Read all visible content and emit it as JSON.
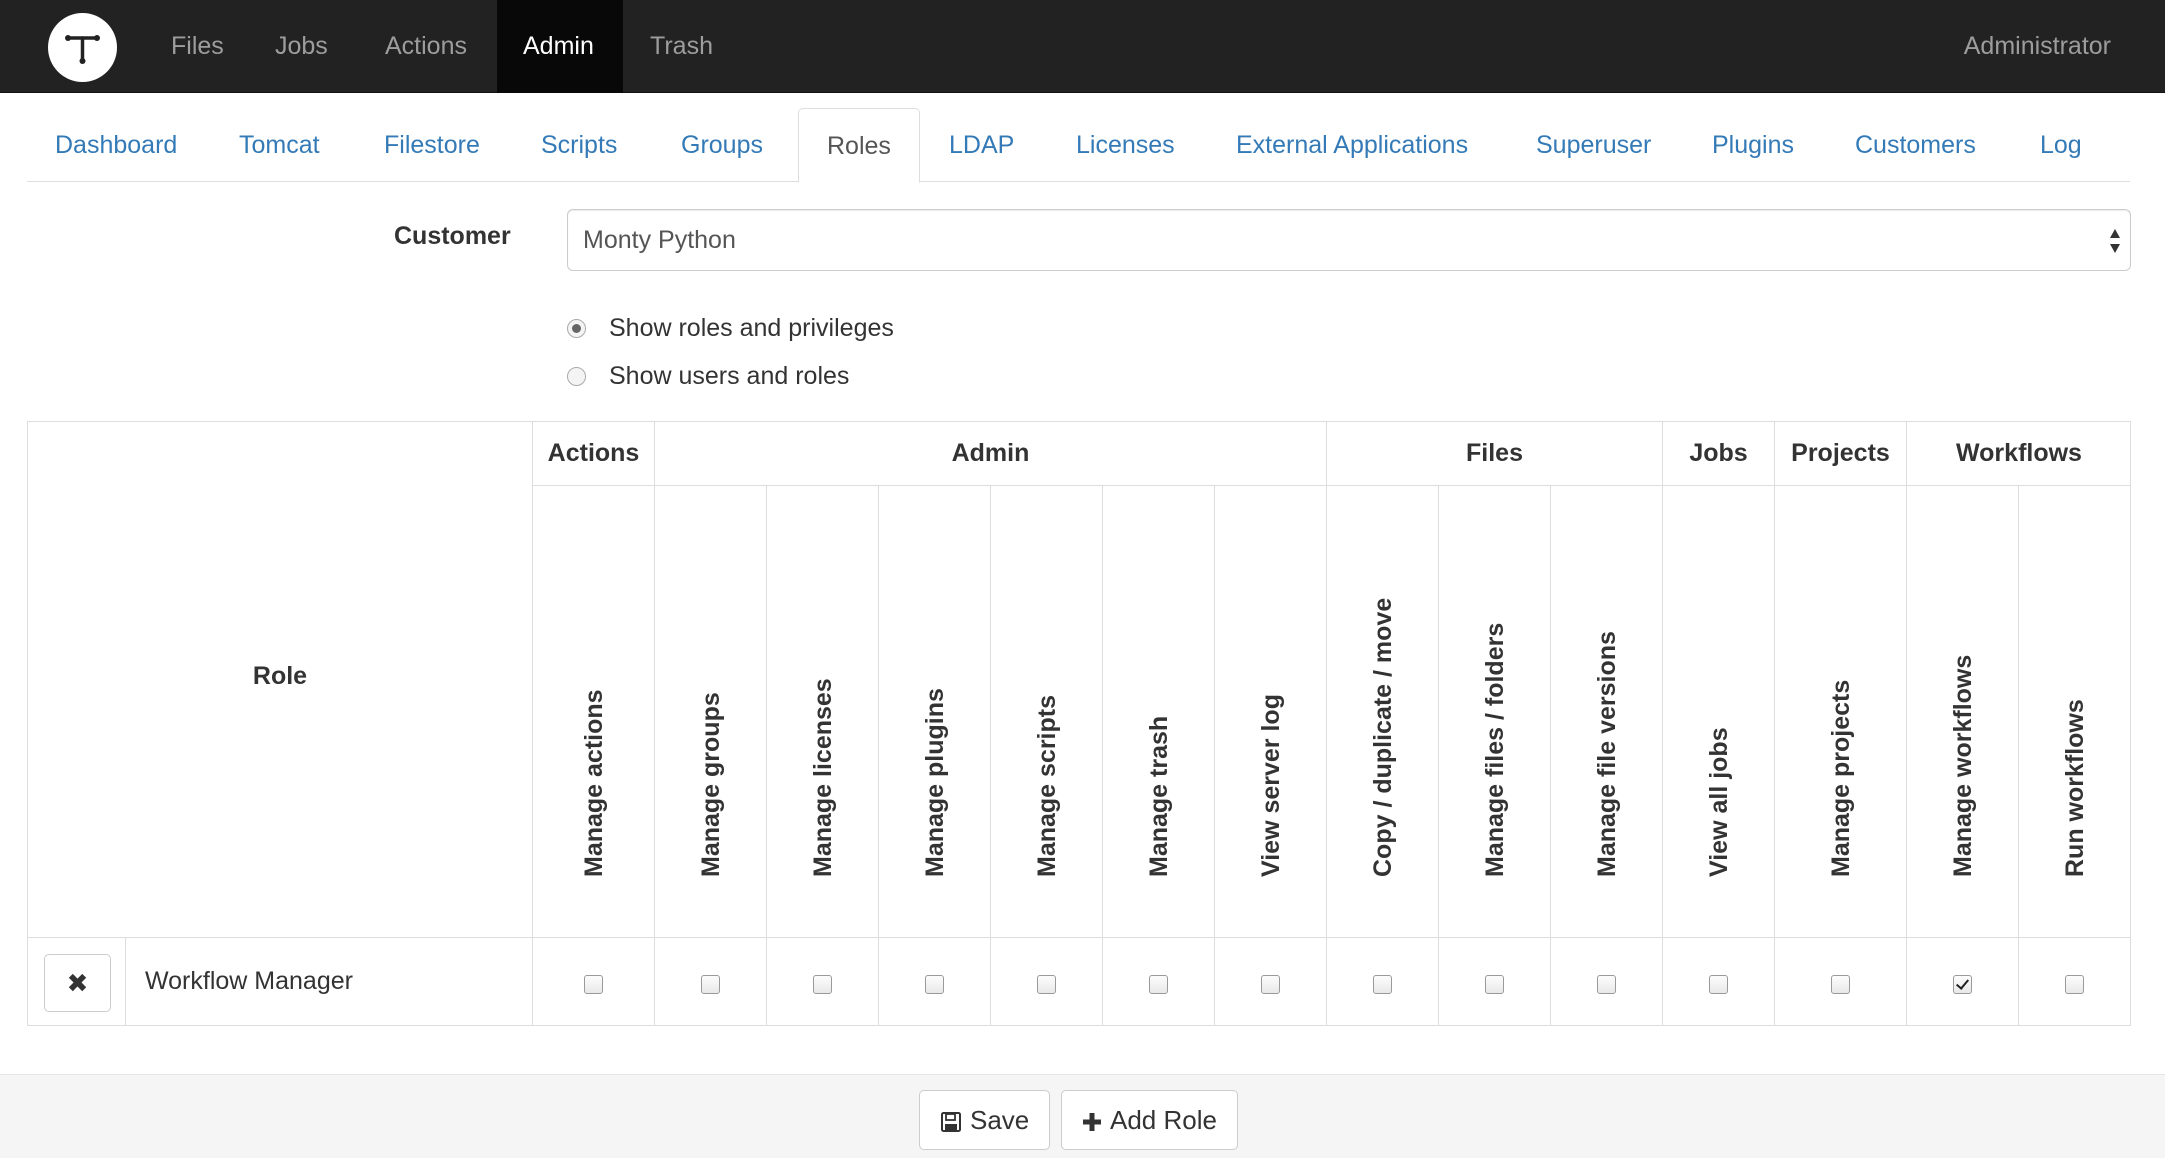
{
  "navbar": {
    "items": [
      {
        "label": "Files"
      },
      {
        "label": "Jobs"
      },
      {
        "label": "Actions"
      },
      {
        "label": "Admin"
      },
      {
        "label": "Trash"
      }
    ],
    "user": "Administrator"
  },
  "tabs": [
    {
      "label": "Dashboard"
    },
    {
      "label": "Tomcat"
    },
    {
      "label": "Filestore"
    },
    {
      "label": "Scripts"
    },
    {
      "label": "Groups"
    },
    {
      "label": "Roles"
    },
    {
      "label": "LDAP"
    },
    {
      "label": "Licenses"
    },
    {
      "label": "External Applications"
    },
    {
      "label": "Superuser"
    },
    {
      "label": "Plugins"
    },
    {
      "label": "Customers"
    },
    {
      "label": "Log"
    }
  ],
  "customer": {
    "label": "Customer",
    "value": "Monty Python"
  },
  "view_options": [
    {
      "label": "Show roles and privileges",
      "checked": true
    },
    {
      "label": "Show users and roles",
      "checked": false
    }
  ],
  "table": {
    "role_header": "Role",
    "groups": [
      {
        "label": "Actions"
      },
      {
        "label": "Admin"
      },
      {
        "label": "Files"
      },
      {
        "label": "Jobs"
      },
      {
        "label": "Projects"
      },
      {
        "label": "Workflows"
      }
    ],
    "columns": [
      "Manage actions",
      "Manage groups",
      "Manage licenses",
      "Manage plugins",
      "Manage scripts",
      "Manage trash",
      "View server log",
      "Copy / duplicate / move",
      "Manage files / folders",
      "Manage file versions",
      "View all jobs",
      "Manage projects",
      "Manage workflows",
      "Run workflows"
    ],
    "rows": [
      {
        "name": "Workflow Manager",
        "checks": [
          false,
          false,
          false,
          false,
          false,
          false,
          false,
          false,
          false,
          false,
          false,
          false,
          true,
          false
        ]
      }
    ]
  },
  "footer": {
    "save_label": "Save",
    "add_role_label": "Add Role"
  }
}
